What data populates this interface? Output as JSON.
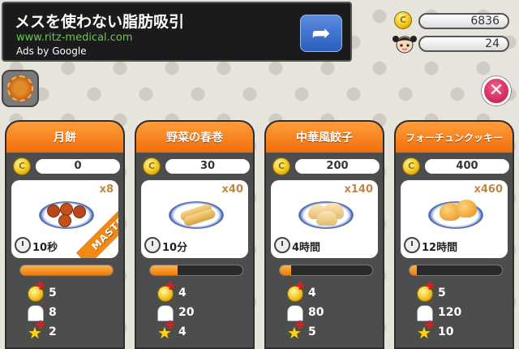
{
  "ad": {
    "title": "メスを使わない脂肪吸引",
    "url": "www.ritz-medical.com",
    "by": "Ads by Google",
    "arrow_icon": "share-arrow-icon"
  },
  "currency": {
    "coins": "6836",
    "customers": "24"
  },
  "colors": {
    "accent": "#f07a10",
    "card_bg": "#4d4d4d",
    "close": "#d41d57"
  },
  "dishes": [
    {
      "name": "月餅",
      "price": "0",
      "multiplier": "x8",
      "time": "10秒",
      "mastered": "MASTERED",
      "progress": 1.0,
      "coins": "5",
      "chefs": "8",
      "stars": "2"
    },
    {
      "name": "野菜の春巻",
      "price": "30",
      "multiplier": "x40",
      "time": "10分",
      "mastered": "",
      "progress": 0.3,
      "coins": "4",
      "chefs": "20",
      "stars": "4"
    },
    {
      "name": "中華風餃子",
      "price": "200",
      "multiplier": "x140",
      "time": "4時間",
      "mastered": "",
      "progress": 0.12,
      "coins": "4",
      "chefs": "80",
      "stars": "5"
    },
    {
      "name": "フォーチュンクッキー",
      "price": "400",
      "multiplier": "x460",
      "time": "12時間",
      "mastered": "",
      "progress": 0.08,
      "coins": "5",
      "chefs": "120",
      "stars": "10"
    }
  ]
}
